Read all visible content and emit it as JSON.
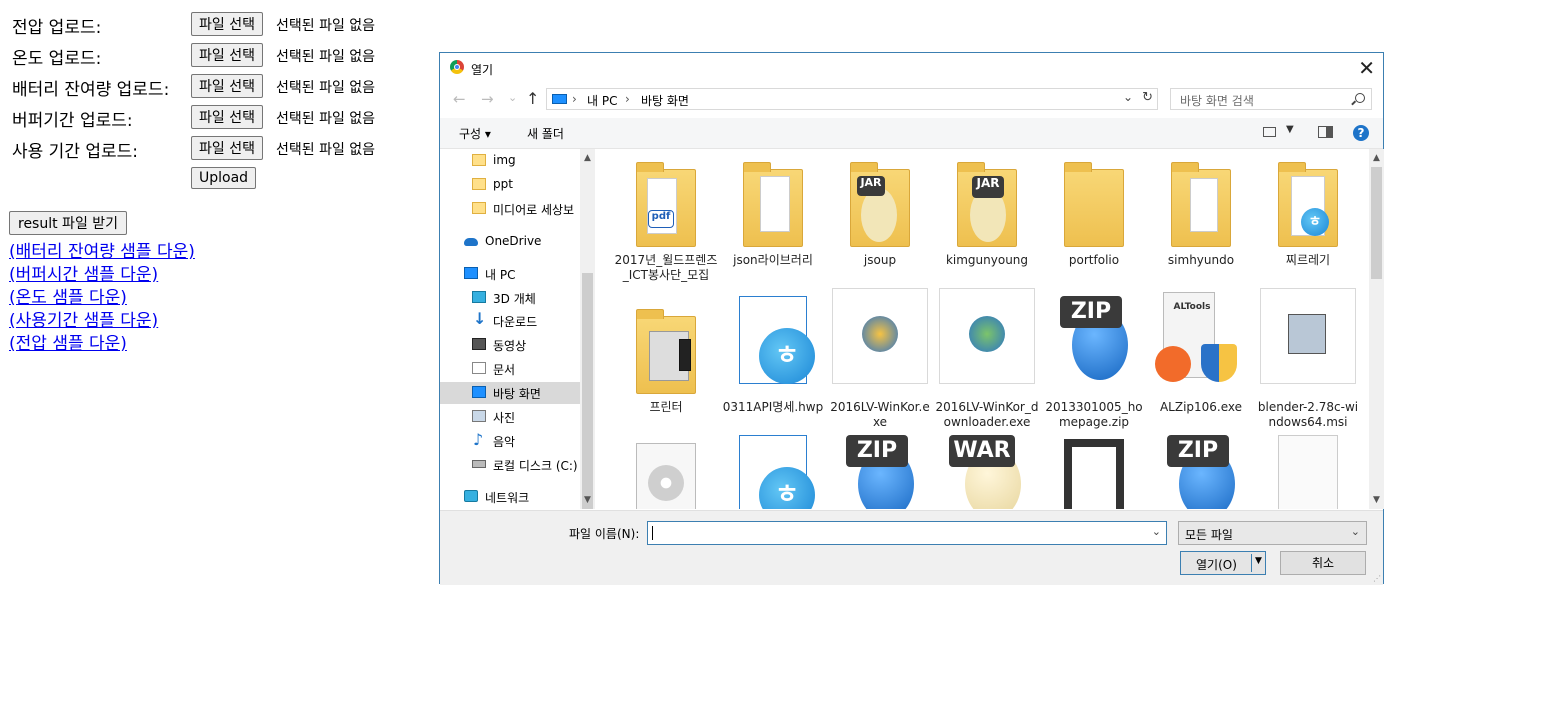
{
  "form": {
    "rows": [
      {
        "label": "전압 업로드:",
        "button": "파일 선택",
        "status": "선택된 파일 없음"
      },
      {
        "label": "온도 업로드:",
        "button": "파일 선택",
        "status": "선택된 파일 없음"
      },
      {
        "label": "배터리 잔여량 업로드:",
        "button": "파일 선택",
        "status": "선택된 파일 없음"
      },
      {
        "label": "버퍼기간 업로드:",
        "button": "파일 선택",
        "status": "선택된 파일 없음"
      },
      {
        "label": "사용 기간 업로드:",
        "button": "파일 선택",
        "status": "선택된 파일 없음"
      }
    ],
    "upload_label": "Upload",
    "result_label": "result 파일 받기",
    "links": [
      "(배터리 잔여량 샘플 다운)",
      "(버퍼시간 샘플 다운)",
      "(온도 샘플 다운)",
      "(사용기간 샘플 다운)",
      "(전압 샘플 다운)"
    ]
  },
  "dialog": {
    "title": "열기",
    "close_glyph": "✕",
    "nav": {
      "back": "←",
      "forward": "→",
      "recent": "⌄",
      "up": "↑"
    },
    "breadcrumb": [
      "내 PC",
      "바탕 화면"
    ],
    "breadcrumb_sep": "›",
    "search_placeholder": "바탕 화면 검색",
    "toolbar": {
      "organize": "구성 ▾",
      "new_folder": "새 폴더",
      "help": "?"
    },
    "nav_pane": [
      {
        "label": "img",
        "icon": "folder-icon"
      },
      {
        "label": "ppt",
        "icon": "folder-icon"
      },
      {
        "label": "미디어로 세상보",
        "icon": "folder-icon"
      },
      {
        "label": "OneDrive",
        "icon": "onedrive-icon"
      },
      {
        "label": "내 PC",
        "icon": "pc-icon"
      },
      {
        "label": "3D 개체",
        "icon": "3d-objects-icon"
      },
      {
        "label": "다운로드",
        "icon": "downloads-icon"
      },
      {
        "label": "동영상",
        "icon": "videos-icon"
      },
      {
        "label": "문서",
        "icon": "documents-icon"
      },
      {
        "label": "바탕 화면",
        "icon": "desktop-icon",
        "selected": true
      },
      {
        "label": "사진",
        "icon": "pictures-icon"
      },
      {
        "label": "음악",
        "icon": "music-icon"
      },
      {
        "label": "로컬 디스크 (C:)",
        "icon": "local-disk-icon"
      },
      {
        "label": "네트워크",
        "icon": "network-icon"
      }
    ],
    "files": [
      {
        "name": "2017년_윌드프렌즈_ICT봉사단_모집",
        "icon": "folder-icon"
      },
      {
        "name": "json라이브러리",
        "icon": "folder-icon"
      },
      {
        "name": "jsoup",
        "icon": "folder-icon"
      },
      {
        "name": "kimgunyoung",
        "icon": "folder-icon"
      },
      {
        "name": "portfolio",
        "icon": "folder-icon"
      },
      {
        "name": "simhyundo",
        "icon": "folder-icon"
      },
      {
        "name": "찌르레기",
        "icon": "folder-icon"
      },
      {
        "name": "프린터",
        "icon": "folder-icon"
      },
      {
        "name": "0311API명세.hwp",
        "icon": "hwp-icon"
      },
      {
        "name": "2016LV-WinKor.exe",
        "icon": "installer-icon"
      },
      {
        "name": "2016LV-WinKor_downloader.exe",
        "icon": "installer-icon"
      },
      {
        "name": "2013301005_homepage.zip",
        "icon": "zip-icon"
      },
      {
        "name": "ALZip106.exe",
        "icon": "alzip-icon"
      },
      {
        "name": "blender-2.78c-windows64.msi",
        "icon": "msi-icon"
      }
    ],
    "badges": {
      "zip": "ZIP",
      "war": "WAR",
      "jar": "JAR",
      "alt": "ALTools",
      "pdf": "pdf",
      "hwp": "ㅎ"
    },
    "filename_label": "파일 이름(N):",
    "filename_value": "",
    "filetype": "모든 파일",
    "open_label": "열기(O)",
    "cancel_label": "취소"
  }
}
